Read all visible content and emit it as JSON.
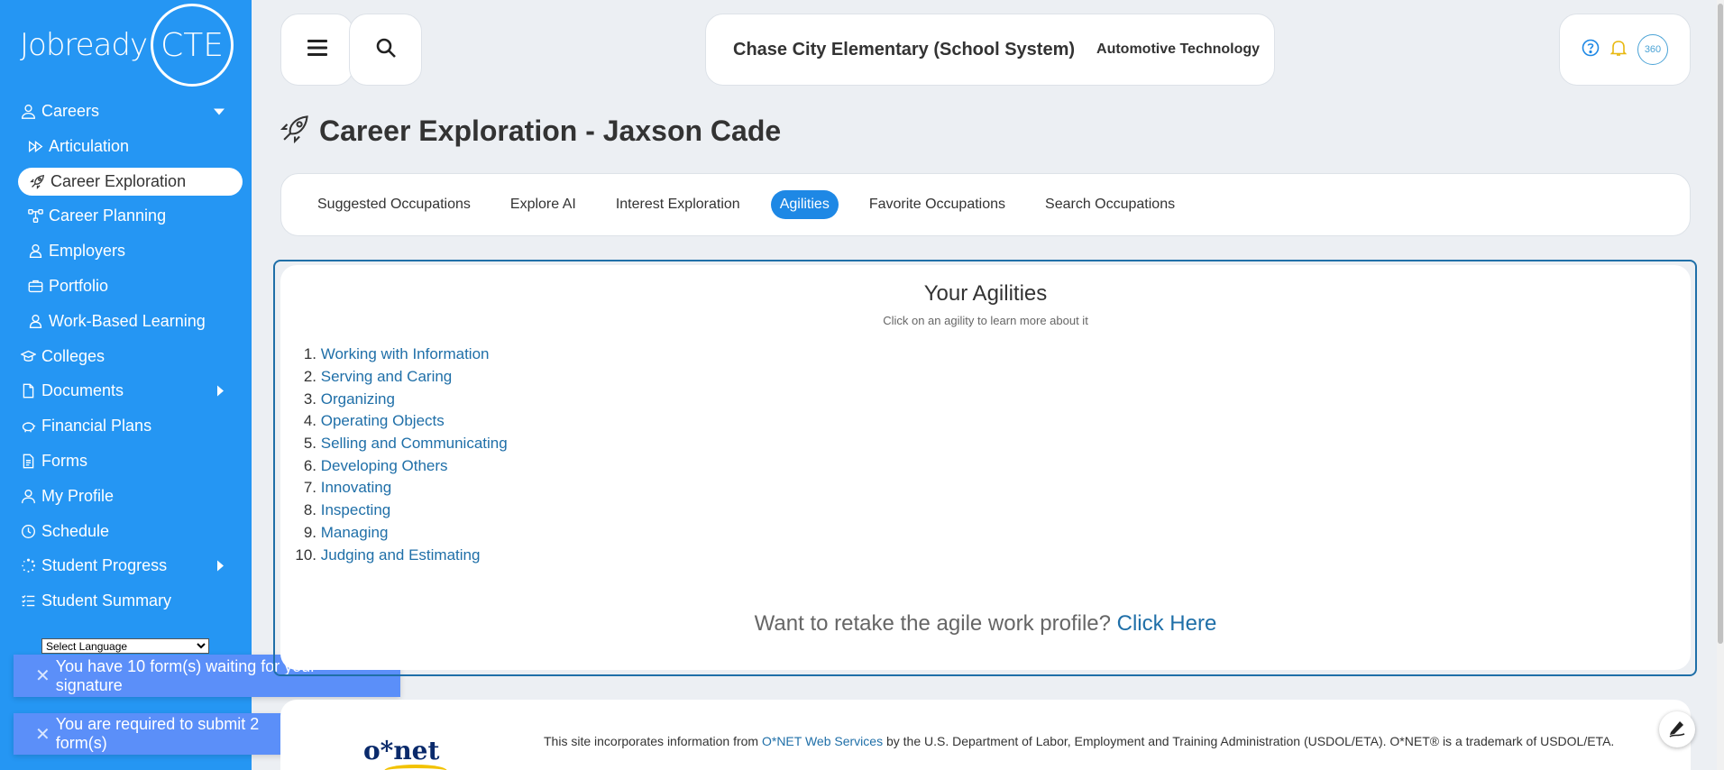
{
  "brand": {
    "logo_text": "Jobready",
    "logo_badge": "CTE"
  },
  "sidebar": {
    "items": [
      {
        "label": "Careers",
        "icon": "user-tie-icon",
        "caret": "down"
      },
      {
        "label": "Articulation",
        "icon": "forward-icon",
        "sub": true
      },
      {
        "label": "Career Exploration",
        "icon": "rocket-icon",
        "sub": true,
        "active": true
      },
      {
        "label": "Career Planning",
        "icon": "sitemap-icon",
        "sub": true
      },
      {
        "label": "Employers",
        "icon": "user-badge-icon",
        "sub": true
      },
      {
        "label": "Portfolio",
        "icon": "briefcase-icon",
        "sub": true
      },
      {
        "label": "Work-Based Learning",
        "icon": "user-badge-icon",
        "sub": true
      },
      {
        "label": "Colleges",
        "icon": "graduation-cap-icon"
      },
      {
        "label": "Documents",
        "icon": "file-icon",
        "caret": "right"
      },
      {
        "label": "Financial Plans",
        "icon": "piggy-bank-icon"
      },
      {
        "label": "Forms",
        "icon": "form-icon"
      },
      {
        "label": "My Profile",
        "icon": "user-icon"
      },
      {
        "label": "Schedule",
        "icon": "clock-icon"
      },
      {
        "label": "Student Progress",
        "icon": "spinner-icon",
        "caret": "right"
      },
      {
        "label": "Student Summary",
        "icon": "list-icon"
      }
    ],
    "language_select": "Select Language"
  },
  "toasts": {
    "signature": "You have 10 form(s) waiting for your signature",
    "submit": "You are required to submit 2 form(s)"
  },
  "header": {
    "school": "Chase City Elementary (School System)",
    "program": "Automotive Technology",
    "avatar_text": "360"
  },
  "page": {
    "title": "Career Exploration - Jaxson Cade"
  },
  "tabs": [
    {
      "label": "Suggested Occupations"
    },
    {
      "label": "Explore AI"
    },
    {
      "label": "Interest Exploration"
    },
    {
      "label": "Agilities",
      "active": true
    },
    {
      "label": "Favorite Occupations"
    },
    {
      "label": "Search Occupations"
    }
  ],
  "agilities": {
    "title": "Your Agilities",
    "subtitle": "Click on an agility to learn more about it",
    "items": [
      {
        "num": "1.",
        "label": "Working with Information"
      },
      {
        "num": "2.",
        "label": "Serving and Caring"
      },
      {
        "num": "3.",
        "label": "Organizing"
      },
      {
        "num": "4.",
        "label": "Operating Objects"
      },
      {
        "num": "5.",
        "label": "Selling and Communicating"
      },
      {
        "num": "6.",
        "label": "Developing Others"
      },
      {
        "num": "7.",
        "label": "Innovating"
      },
      {
        "num": "8.",
        "label": "Inspecting"
      },
      {
        "num": "9.",
        "label": "Managing"
      },
      {
        "num": "10.",
        "label": "Judging and Estimating"
      }
    ],
    "retake_prompt": "Want to retake the agile work profile?",
    "retake_link": "Click Here"
  },
  "footer": {
    "logo": "o*net",
    "text_before": "This site incorporates information from ",
    "link": "O*NET Web Services",
    "text_after": " by the U.S. Department of Labor, Employment and Training Administration (USDOL/ETA). O*NET® is a trademark of USDOL/ETA."
  },
  "colors": {
    "sidebar": "#2596f3",
    "accent": "#1e88e5",
    "link": "#1f6fa8",
    "toast": "#5b8ff9"
  }
}
